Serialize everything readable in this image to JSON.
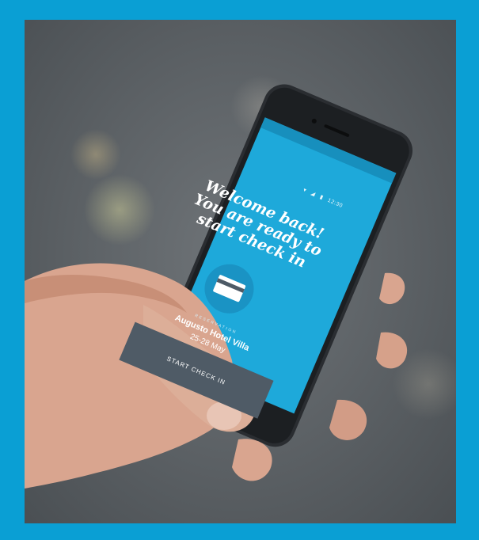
{
  "photo": {
    "description_icon": "hand-holding-phone",
    "colors": {
      "frame": "#0a9fd4",
      "screen": "#1ea9da",
      "button": "#4f5b66"
    }
  },
  "app": {
    "status_time": "12:30",
    "welcome_lines": [
      "Welcome back!",
      "You are ready to",
      "start check in"
    ],
    "card_icon": "credit-card-icon",
    "reservation_label": "RESERVATION",
    "hotel_name": "Augusto Hotel Villa",
    "dates": "25-28 May",
    "cta_label": "START CHECK IN"
  }
}
